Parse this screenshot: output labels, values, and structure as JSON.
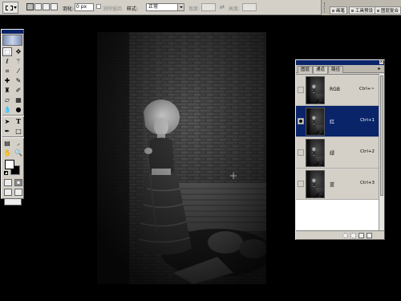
{
  "options_bar": {
    "feather_label": "羽化:",
    "feather_value": "0 px",
    "antialias_label": "消除锯齿",
    "style_label": "样式:",
    "style_value": "正常",
    "width_label": "宽度:",
    "height_label": "高度:",
    "palette_tabs": [
      "画笔",
      "工具预设",
      "图层复合"
    ]
  },
  "channels_panel": {
    "tabs": [
      "图层",
      "通道",
      "路径"
    ],
    "active_tab": "通道",
    "channels": [
      {
        "name": "RGB",
        "shortcut": "Ctrl+~",
        "selected": false,
        "visible": false
      },
      {
        "name": "红",
        "shortcut": "Ctrl+1",
        "selected": true,
        "visible": true
      },
      {
        "name": "绿",
        "shortcut": "Ctrl+2",
        "selected": false,
        "visible": false
      },
      {
        "name": "蓝",
        "shortcut": "Ctrl+3",
        "selected": false,
        "visible": false
      }
    ]
  },
  "colors": {
    "ui_gray": "#d4d0c8",
    "selection_blue": "#0a246a",
    "workspace": "#000000"
  },
  "icons": {
    "toolbox": [
      "marquee-icon",
      "move-icon",
      "lasso-icon",
      "magic-wand-icon",
      "crop-icon",
      "slice-icon",
      "healing-icon",
      "brush-icon",
      "stamp-icon",
      "history-brush-icon",
      "eraser-icon",
      "gradient-icon",
      "blur-icon",
      "dodge-icon",
      "path-select-icon",
      "type-icon",
      "pen-icon",
      "shape-icon",
      "notes-icon",
      "eyedropper-icon",
      "hand-icon",
      "zoom-icon"
    ]
  }
}
